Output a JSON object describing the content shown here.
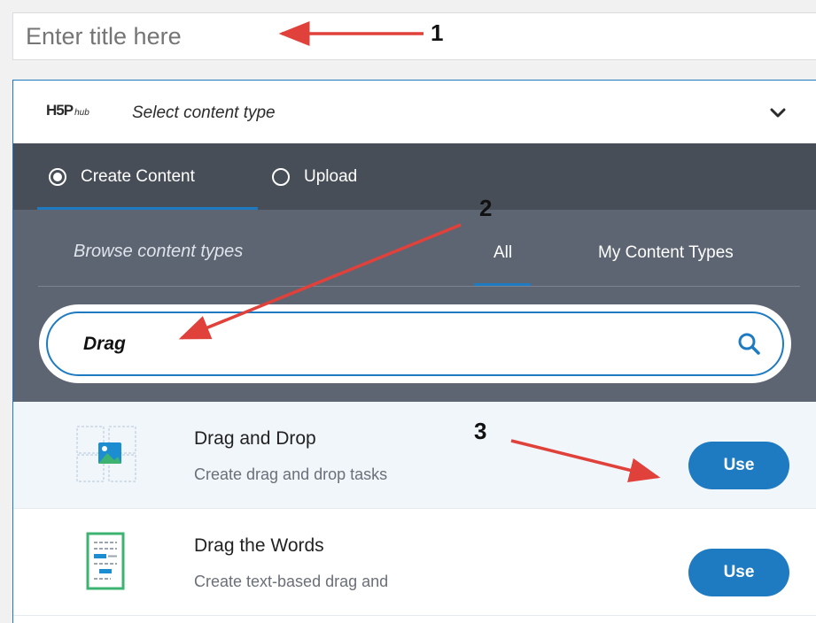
{
  "title_field": {
    "placeholder": "Enter title here"
  },
  "hub": {
    "logo_text": "H5P",
    "logo_sub": "hub",
    "select_label": "Select content type",
    "tabs": [
      {
        "label": "Create Content",
        "selected": true
      },
      {
        "label": "Upload",
        "selected": false
      }
    ],
    "browse_title": "Browse content types",
    "filters": [
      {
        "label": "All",
        "active": true
      },
      {
        "label": "My Content Types",
        "active": false
      }
    ],
    "search": {
      "value": "Drag"
    },
    "results": [
      {
        "title": "Drag and Drop",
        "description": "Create drag and drop tasks",
        "button": "Use",
        "icon": "drag-and-drop-icon"
      },
      {
        "title": "Drag the Words",
        "description": "Create text-based drag and",
        "button": "Use",
        "icon": "drag-the-words-icon"
      }
    ]
  },
  "annotations": [
    {
      "number": "1"
    },
    {
      "number": "2"
    },
    {
      "number": "3"
    }
  ],
  "colors": {
    "accent": "#1f7bc1",
    "tabs_bg": "#484e58",
    "browse_bg": "#5d6573",
    "arrow": "#e0413a"
  }
}
